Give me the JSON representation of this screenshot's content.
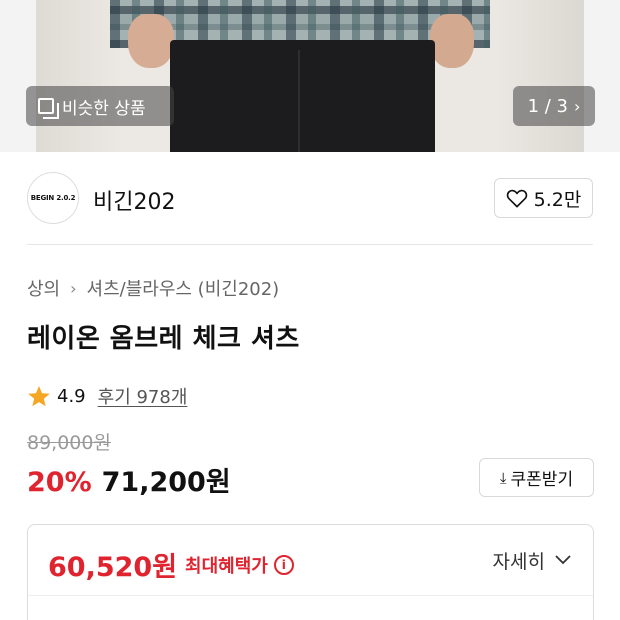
{
  "gallery": {
    "similar_label": "비슷한 상품",
    "pager_text": "1 / 3"
  },
  "brand": {
    "logo_text": "BEGIN 2.0.2",
    "name": "비긴202",
    "likes": "5.2만"
  },
  "breadcrumb": {
    "category": "상의",
    "subcategory": "셔츠/블라우스 (비긴202)"
  },
  "product": {
    "title": "레이온 옴브레 체크 셔츠",
    "rating": "4.9",
    "reviews": "후기 978개",
    "original_price": "89,000원",
    "discount": "20%",
    "price": "71,200원",
    "coupon_label": "쿠폰받기"
  },
  "best_price": {
    "price": "60,520원",
    "label": "최대혜택가",
    "detail_label": "자세히"
  },
  "colors": {
    "accent_red": "#e0242f",
    "star": "#f5a623"
  }
}
